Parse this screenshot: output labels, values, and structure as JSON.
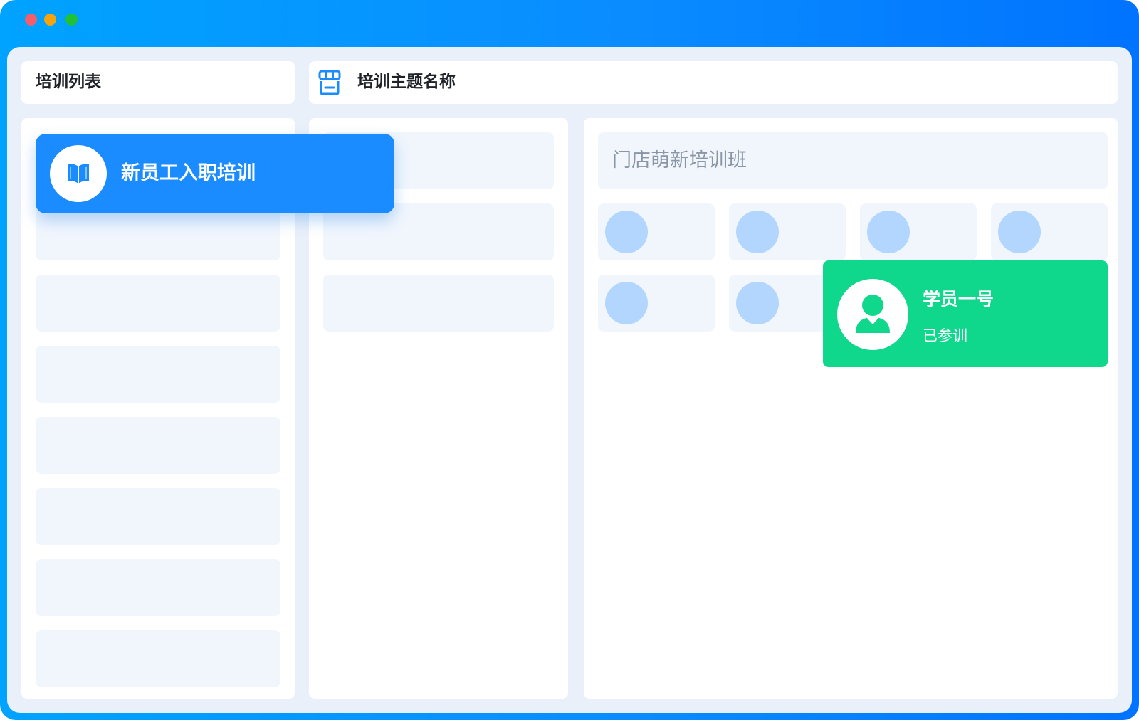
{
  "window": {
    "controls": [
      "close",
      "minimize",
      "maximize"
    ]
  },
  "sidebar": {
    "title": "培训列表",
    "active_item": {
      "label": "新员工入职培训",
      "icon": "book-icon"
    }
  },
  "header": {
    "icon": "store-icon",
    "title": "培训主题名称"
  },
  "detail": {
    "class_name": "门店萌新培训班"
  },
  "student_card": {
    "name": "学员一号",
    "status": "已参训",
    "icon": "user-icon"
  },
  "colors": {
    "accent_blue": "#1a8cff",
    "success_green": "#0fd88c",
    "surface": "#eaf0fa",
    "placeholder": "#f1f6fd",
    "avatar_placeholder": "#b2d6fd"
  }
}
